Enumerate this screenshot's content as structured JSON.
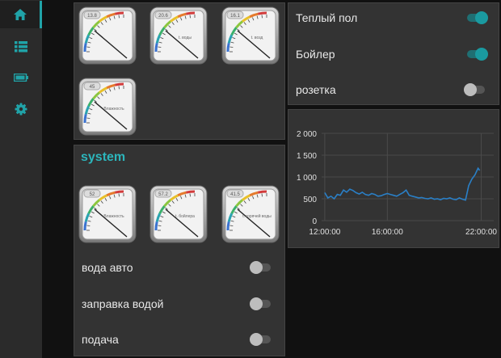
{
  "nav": {
    "items": [
      {
        "icon": "home-icon"
      },
      {
        "icon": "list-icon"
      },
      {
        "icon": "battery-icon"
      },
      {
        "icon": "gear-icon"
      }
    ]
  },
  "gauges_top": [
    {
      "label": "",
      "value": "13.8"
    },
    {
      "label": "t. воды",
      "value": "20.6"
    },
    {
      "label": "t. возд",
      "value": "16.1"
    },
    {
      "label": "Влажность",
      "value": "45"
    }
  ],
  "system": {
    "title": "system",
    "gauges": [
      {
        "label": "Влажность",
        "value": "52"
      },
      {
        "label": "t. бойлера",
        "value": "57.2"
      },
      {
        "label": "t. горячей воды",
        "value": "41.5"
      }
    ],
    "switches": [
      {
        "label": "вода авто",
        "state": false
      },
      {
        "label": "заправка водой",
        "state": false
      },
      {
        "label": "подача",
        "state": false
      }
    ]
  },
  "switches": [
    {
      "label": "Теплый пол",
      "state": true
    },
    {
      "label": "Бойлер",
      "state": true
    },
    {
      "label": "розетка",
      "state": false
    }
  ],
  "colors": {
    "accent": "#20a3a8",
    "line": "#2a7fc6"
  },
  "chart_data": {
    "type": "line",
    "y_ticks": [
      "2 000",
      "1 500",
      "1 000",
      "500",
      "0"
    ],
    "x_ticks": [
      "12:00:00",
      "16:00:00",
      "22:00:00"
    ],
    "ylim": [
      0,
      2000
    ],
    "x_hours": [
      11.8,
      22.8
    ],
    "series": [
      {
        "x": [
          12.0,
          12.2,
          12.4,
          12.6,
          12.8,
          13.0,
          13.2,
          13.4,
          13.6,
          13.8,
          14.0,
          14.2,
          14.4,
          14.6,
          14.8,
          15.0,
          15.2,
          15.4,
          15.6,
          15.8,
          16.0,
          16.2,
          16.4,
          16.6,
          16.8,
          17.0,
          17.2,
          17.4,
          17.6,
          17.8,
          18.0,
          18.2,
          18.4,
          18.6,
          18.8,
          19.0,
          19.2,
          19.4,
          19.6,
          19.8,
          20.0,
          20.2,
          20.4,
          20.6,
          20.8,
          21.0,
          21.2,
          21.4,
          21.6,
          21.8,
          21.9
        ],
        "y": [
          640,
          520,
          560,
          500,
          600,
          580,
          700,
          650,
          720,
          690,
          640,
          610,
          650,
          600,
          580,
          620,
          600,
          560,
          570,
          600,
          620,
          600,
          580,
          560,
          600,
          640,
          700,
          580,
          560,
          540,
          520,
          530,
          510,
          500,
          520,
          490,
          500,
          480,
          510,
          500,
          520,
          490,
          480,
          520,
          490,
          470,
          800,
          950,
          1050,
          1200,
          1150
        ]
      }
    ]
  }
}
